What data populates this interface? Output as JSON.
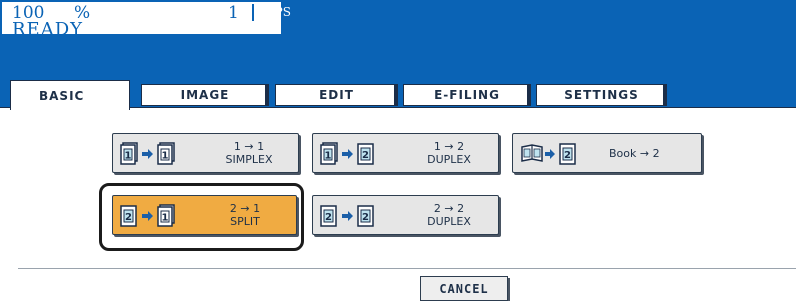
{
  "status": {
    "zoom_value": "100",
    "zoom_unit": "%",
    "copy_count": "1",
    "paper_mode": "APS",
    "state": "READY"
  },
  "tabs": [
    {
      "label": "BASIC",
      "selected": true
    },
    {
      "label": "IMAGE",
      "selected": false
    },
    {
      "label": "EDIT",
      "selected": false
    },
    {
      "label": "E-FILING",
      "selected": false
    },
    {
      "label": "SETTINGS",
      "selected": false
    }
  ],
  "modes": {
    "simplex": {
      "line1": "1 → 1",
      "line2": "SIMPLEX",
      "icon": "simplex-1-to-1-icon",
      "selected": false
    },
    "duplex_1_2": {
      "line1": "1 → 2",
      "line2": "DUPLEX",
      "icon": "duplex-1-to-2-icon",
      "selected": false
    },
    "book": {
      "line1": "Book → 2",
      "icon": "book-to-2-icon",
      "selected": false
    },
    "split": {
      "line1": "2 → 1",
      "line2": "SPLIT",
      "icon": "split-2-to-1-icon",
      "selected": true
    },
    "duplex_2_2": {
      "line1": "2 → 2",
      "line2": "DUPLEX",
      "icon": "duplex-2-to-2-icon",
      "selected": false
    }
  },
  "footer": {
    "cancel_label": "CANCEL"
  },
  "colors": {
    "header_blue": "#0a63b5",
    "selected_orange": "#f0ab42",
    "button_gray": "#e6e6e6",
    "border_dark": "#1b2d48"
  }
}
